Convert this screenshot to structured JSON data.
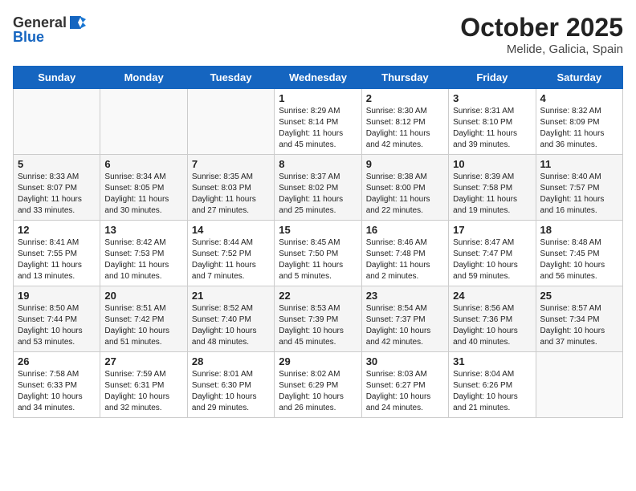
{
  "header": {
    "logo_general": "General",
    "logo_blue": "Blue",
    "month": "October 2025",
    "location": "Melide, Galicia, Spain"
  },
  "days_of_week": [
    "Sunday",
    "Monday",
    "Tuesday",
    "Wednesday",
    "Thursday",
    "Friday",
    "Saturday"
  ],
  "weeks": [
    [
      {
        "day": "",
        "info": ""
      },
      {
        "day": "",
        "info": ""
      },
      {
        "day": "",
        "info": ""
      },
      {
        "day": "1",
        "info": "Sunrise: 8:29 AM\nSunset: 8:14 PM\nDaylight: 11 hours\nand 45 minutes."
      },
      {
        "day": "2",
        "info": "Sunrise: 8:30 AM\nSunset: 8:12 PM\nDaylight: 11 hours\nand 42 minutes."
      },
      {
        "day": "3",
        "info": "Sunrise: 8:31 AM\nSunset: 8:10 PM\nDaylight: 11 hours\nand 39 minutes."
      },
      {
        "day": "4",
        "info": "Sunrise: 8:32 AM\nSunset: 8:09 PM\nDaylight: 11 hours\nand 36 minutes."
      }
    ],
    [
      {
        "day": "5",
        "info": "Sunrise: 8:33 AM\nSunset: 8:07 PM\nDaylight: 11 hours\nand 33 minutes."
      },
      {
        "day": "6",
        "info": "Sunrise: 8:34 AM\nSunset: 8:05 PM\nDaylight: 11 hours\nand 30 minutes."
      },
      {
        "day": "7",
        "info": "Sunrise: 8:35 AM\nSunset: 8:03 PM\nDaylight: 11 hours\nand 27 minutes."
      },
      {
        "day": "8",
        "info": "Sunrise: 8:37 AM\nSunset: 8:02 PM\nDaylight: 11 hours\nand 25 minutes."
      },
      {
        "day": "9",
        "info": "Sunrise: 8:38 AM\nSunset: 8:00 PM\nDaylight: 11 hours\nand 22 minutes."
      },
      {
        "day": "10",
        "info": "Sunrise: 8:39 AM\nSunset: 7:58 PM\nDaylight: 11 hours\nand 19 minutes."
      },
      {
        "day": "11",
        "info": "Sunrise: 8:40 AM\nSunset: 7:57 PM\nDaylight: 11 hours\nand 16 minutes."
      }
    ],
    [
      {
        "day": "12",
        "info": "Sunrise: 8:41 AM\nSunset: 7:55 PM\nDaylight: 11 hours\nand 13 minutes."
      },
      {
        "day": "13",
        "info": "Sunrise: 8:42 AM\nSunset: 7:53 PM\nDaylight: 11 hours\nand 10 minutes."
      },
      {
        "day": "14",
        "info": "Sunrise: 8:44 AM\nSunset: 7:52 PM\nDaylight: 11 hours\nand 7 minutes."
      },
      {
        "day": "15",
        "info": "Sunrise: 8:45 AM\nSunset: 7:50 PM\nDaylight: 11 hours\nand 5 minutes."
      },
      {
        "day": "16",
        "info": "Sunrise: 8:46 AM\nSunset: 7:48 PM\nDaylight: 11 hours\nand 2 minutes."
      },
      {
        "day": "17",
        "info": "Sunrise: 8:47 AM\nSunset: 7:47 PM\nDaylight: 10 hours\nand 59 minutes."
      },
      {
        "day": "18",
        "info": "Sunrise: 8:48 AM\nSunset: 7:45 PM\nDaylight: 10 hours\nand 56 minutes."
      }
    ],
    [
      {
        "day": "19",
        "info": "Sunrise: 8:50 AM\nSunset: 7:44 PM\nDaylight: 10 hours\nand 53 minutes."
      },
      {
        "day": "20",
        "info": "Sunrise: 8:51 AM\nSunset: 7:42 PM\nDaylight: 10 hours\nand 51 minutes."
      },
      {
        "day": "21",
        "info": "Sunrise: 8:52 AM\nSunset: 7:40 PM\nDaylight: 10 hours\nand 48 minutes."
      },
      {
        "day": "22",
        "info": "Sunrise: 8:53 AM\nSunset: 7:39 PM\nDaylight: 10 hours\nand 45 minutes."
      },
      {
        "day": "23",
        "info": "Sunrise: 8:54 AM\nSunset: 7:37 PM\nDaylight: 10 hours\nand 42 minutes."
      },
      {
        "day": "24",
        "info": "Sunrise: 8:56 AM\nSunset: 7:36 PM\nDaylight: 10 hours\nand 40 minutes."
      },
      {
        "day": "25",
        "info": "Sunrise: 8:57 AM\nSunset: 7:34 PM\nDaylight: 10 hours\nand 37 minutes."
      }
    ],
    [
      {
        "day": "26",
        "info": "Sunrise: 7:58 AM\nSunset: 6:33 PM\nDaylight: 10 hours\nand 34 minutes."
      },
      {
        "day": "27",
        "info": "Sunrise: 7:59 AM\nSunset: 6:31 PM\nDaylight: 10 hours\nand 32 minutes."
      },
      {
        "day": "28",
        "info": "Sunrise: 8:01 AM\nSunset: 6:30 PM\nDaylight: 10 hours\nand 29 minutes."
      },
      {
        "day": "29",
        "info": "Sunrise: 8:02 AM\nSunset: 6:29 PM\nDaylight: 10 hours\nand 26 minutes."
      },
      {
        "day": "30",
        "info": "Sunrise: 8:03 AM\nSunset: 6:27 PM\nDaylight: 10 hours\nand 24 minutes."
      },
      {
        "day": "31",
        "info": "Sunrise: 8:04 AM\nSunset: 6:26 PM\nDaylight: 10 hours\nand 21 minutes."
      },
      {
        "day": "",
        "info": ""
      }
    ]
  ]
}
